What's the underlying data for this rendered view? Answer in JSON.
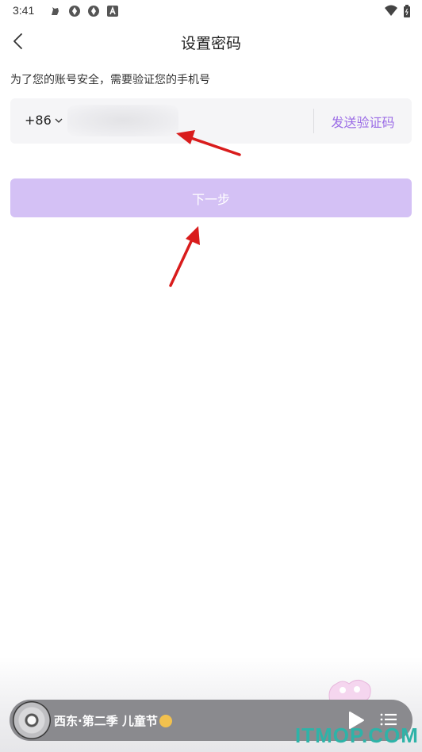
{
  "status_bar": {
    "time": "3:41",
    "left_icons": [
      "notification-pet-icon",
      "app-icon",
      "app-icon",
      "a-icon"
    ],
    "right_icons": [
      "wifi-icon",
      "battery-icon"
    ]
  },
  "nav": {
    "title": "设置密码",
    "back_icon": "chevron-left-icon"
  },
  "form": {
    "hint": "为了您的账号安全，需要验证您的手机号",
    "country_code": "+86",
    "phone_value_blurred": true,
    "send_code_label": "发送验证码",
    "next_label": "下一步"
  },
  "player": {
    "track_title": "西东·第二季 儿童节",
    "play_icon": "play-icon",
    "playlist_icon": "playlist-icon"
  },
  "watermark": {
    "text": "ITMOP.COM"
  },
  "colors": {
    "accent": "#9b6ce6",
    "next_button_disabled": "#d4c1f5",
    "input_bg": "#f5f5f7",
    "annotation_arrow": "#d91c1c",
    "watermark": "#2eb3a8"
  }
}
